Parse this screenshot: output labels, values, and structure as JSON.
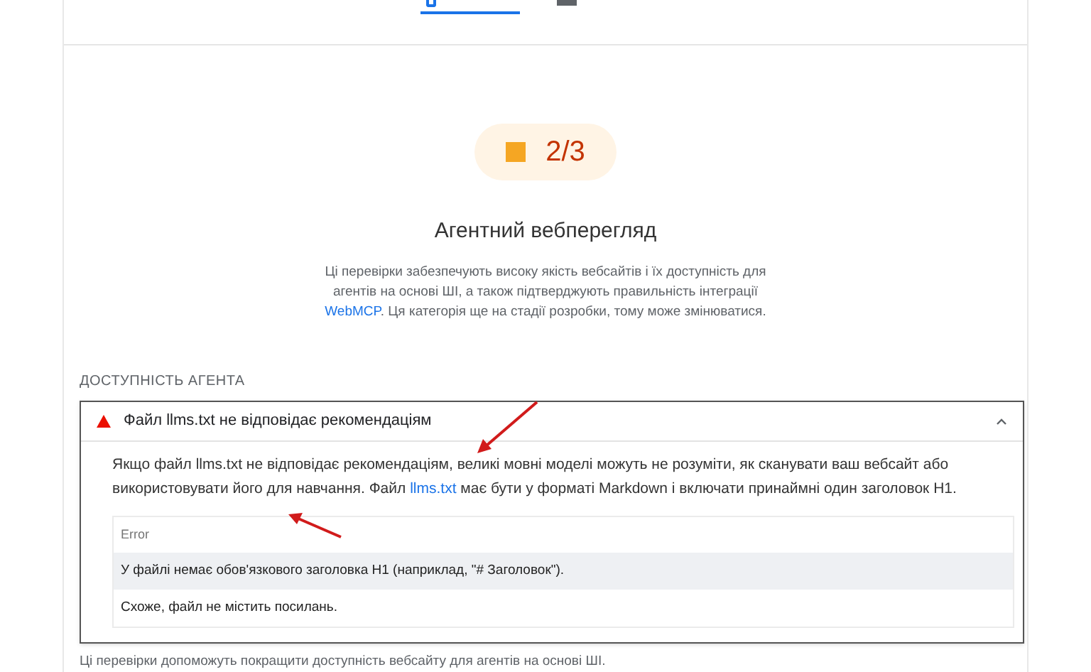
{
  "tabs": [
    {
      "selected": true
    },
    {
      "selected": false
    }
  ],
  "score": {
    "value": "2/3",
    "color": "#f5a623"
  },
  "category": {
    "title": "Агентний вебперегляд",
    "description_before": "Ці перевірки забезпечують високу якість вебсайтів і їх доступність для агентів на основі ШІ, а також підтверджують правильність інтеграції",
    "description_link": "WebMCP",
    "description_after": ". Ця категорія ще на стадії розробки, тому може змінюватися."
  },
  "section_label": "ДОСТУПНІСТЬ АГЕНТА",
  "audit": {
    "title": "Файл llms.txt не відповідає рекомендаціям",
    "expanded": true,
    "kind": "warning",
    "body_before": "Якщо файл llms.txt не відповідає рекомендаціям, великі мовні моделі можуть не розуміти, як сканувати ваш вебсайт або використовувати його для навчання. Файл",
    "body_link": "llms.txt",
    "body_after": "має бути у форматі Markdown і включати принаймні один заголовок H1.",
    "table_header": "Error",
    "rows": [
      {
        "text": "У файлі немає обов'язкового заголовка H1 (наприклад, \"# Заголовок\").",
        "selected": true
      },
      {
        "text": "Схоже, файл не містить посилань.",
        "selected": false
      }
    ]
  },
  "footer": "Ці перевірки допоможуть покращити доступність вебсайту для агентів на основі ШІ."
}
